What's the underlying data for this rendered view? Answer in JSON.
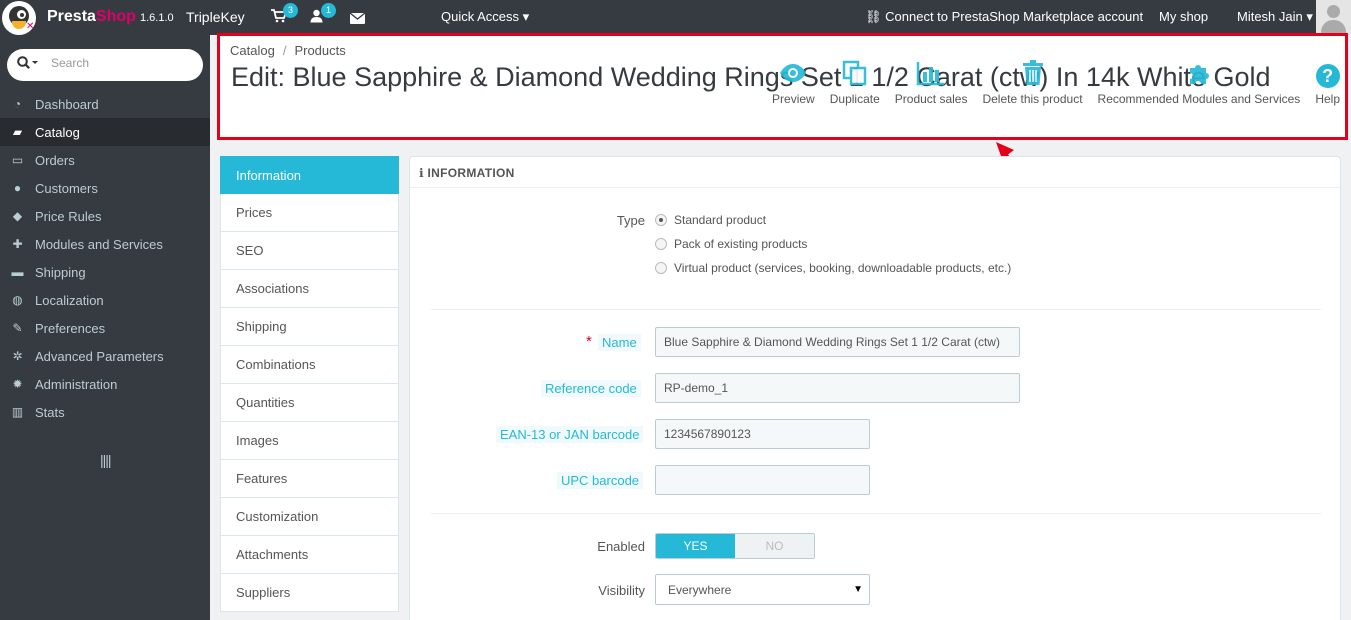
{
  "topbar": {
    "brand_presta": "Presta",
    "brand_shop": "Shop",
    "version": "1.6.1.0",
    "shop_name": "TripleKey",
    "orders_badge": "3",
    "customers_badge": "1",
    "quick_access": "Quick Access ▾",
    "connect": "Connect to PrestaShop Marketplace account",
    "my_shop": "My shop",
    "user_name": "Mitesh Jain ▾"
  },
  "sidebar": {
    "search_placeholder": "Search",
    "items": [
      {
        "label": "Dashboard",
        "icon": "dashboard-icon"
      },
      {
        "label": "Catalog",
        "icon": "book-icon"
      },
      {
        "label": "Orders",
        "icon": "credit-card-icon"
      },
      {
        "label": "Customers",
        "icon": "users-icon"
      },
      {
        "label": "Price Rules",
        "icon": "tags-icon"
      },
      {
        "label": "Modules and Services",
        "icon": "puzzle-icon"
      },
      {
        "label": "Shipping",
        "icon": "truck-icon"
      },
      {
        "label": "Localization",
        "icon": "globe-icon"
      },
      {
        "label": "Preferences",
        "icon": "wrench-icon"
      },
      {
        "label": "Advanced Parameters",
        "icon": "cogs-icon"
      },
      {
        "label": "Administration",
        "icon": "cog-icon"
      },
      {
        "label": "Stats",
        "icon": "bar-chart-icon"
      }
    ],
    "active_item": "Catalog"
  },
  "header": {
    "breadcrumb": [
      "Catalog",
      "Products"
    ],
    "title": "Edit: Blue Sapphire & Diamond Wedding Rings Set 1 1/2 Carat (ctw) In 14k White Gold",
    "toolbar": [
      {
        "label": "Preview",
        "icon": "eye-icon"
      },
      {
        "label": "Duplicate",
        "icon": "copy-icon"
      },
      {
        "label": "Product sales",
        "icon": "chart-icon"
      },
      {
        "label": "Delete this product",
        "icon": "trash-icon"
      },
      {
        "label": "Recommended Modules and Services",
        "icon": "puzzle-icon"
      },
      {
        "label": "Help",
        "icon": "help-icon"
      }
    ]
  },
  "tabs": [
    "Information",
    "Prices",
    "SEO",
    "Associations",
    "Shipping",
    "Combinations",
    "Quantities",
    "Images",
    "Features",
    "Customization",
    "Attachments",
    "Suppliers"
  ],
  "panel": {
    "heading": "INFORMATION",
    "type_label": "Type",
    "type_options": [
      "Standard product",
      "Pack of existing products",
      "Virtual product (services, booking, downloadable products, etc.)"
    ],
    "name_label": "Name",
    "name_value": "Blue Sapphire & Diamond Wedding Rings Set 1 1/2 Carat (ctw)",
    "reference_label": "Reference code",
    "reference_value": "RP-demo_1",
    "ean_label": "EAN-13 or JAN barcode",
    "ean_value": "1234567890123",
    "upc_label": "UPC barcode",
    "upc_value": "",
    "enabled_label": "Enabled",
    "enabled_yes": "YES",
    "enabled_no": "NO",
    "visibility_label": "Visibility",
    "visibility_value": "Everywhere"
  },
  "colors": {
    "accent": "#25b9d7",
    "annotation_red": "#e3001b",
    "topbar": "#363a41"
  }
}
